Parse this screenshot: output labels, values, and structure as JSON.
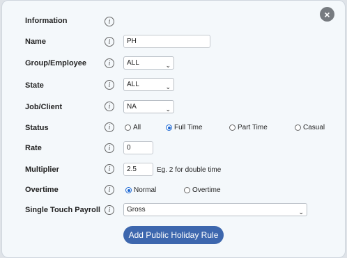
{
  "dialog": {
    "close_label": "×",
    "info_glyph": "i",
    "rows": {
      "information": {
        "label": "Information"
      },
      "name": {
        "label": "Name",
        "value": "PH"
      },
      "group": {
        "label": "Group/Employee",
        "value": "ALL"
      },
      "state": {
        "label": "State",
        "value": "ALL"
      },
      "job": {
        "label": "Job/Client",
        "value": "NA"
      },
      "status": {
        "label": "Status",
        "options": [
          "All",
          "Full Time",
          "Part Time",
          "Casual"
        ],
        "selected": "Full Time"
      },
      "rate": {
        "label": "Rate",
        "value": "0"
      },
      "multiplier": {
        "label": "Multiplier",
        "value": "2.5",
        "hint": "Eg. 2 for double time"
      },
      "overtime": {
        "label": "Overtime",
        "options": [
          "Normal",
          "Overtime"
        ],
        "selected": "Normal"
      },
      "stp": {
        "label": "Single Touch Payroll",
        "value": "Gross"
      }
    },
    "submit_label": "Add Public Holiday Rule",
    "caret": "⌄"
  },
  "colors": {
    "accent": "#3d67ae",
    "radio": "#1a66d2",
    "background": "#f4f8fb"
  }
}
